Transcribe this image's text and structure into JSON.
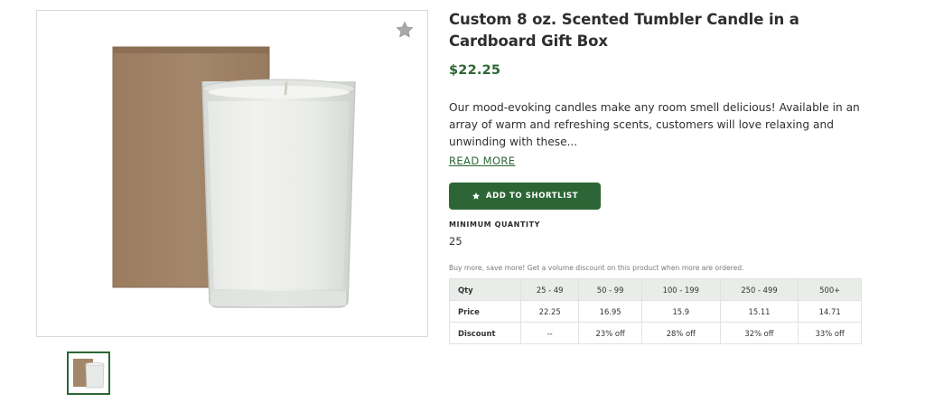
{
  "product": {
    "title": "Custom 8 oz. Scented Tumbler Candle in a Cardboard Gift Box",
    "price": "$22.25",
    "description": "Our mood-evoking candles make any room smell delicious! Available in an array of warm and refreshing scents, customers will love relaxing and unwinding with these...",
    "read_more": "READ MORE",
    "shortlist_label": "ADD TO SHORTLIST",
    "min_qty_label": "MINIMUM QUANTITY",
    "min_qty_value": "25",
    "volume_note": "Buy more, save more! Get a volume discount on this product when more are ordered."
  },
  "pricing": {
    "header": [
      "Qty",
      "25 - 49",
      "50 - 99",
      "100 - 199",
      "250 - 499",
      "500+"
    ],
    "price_row": [
      "Price",
      "22.25",
      "16.95",
      "15.9",
      "15.11",
      "14.71"
    ],
    "discount_row": [
      "Discount",
      "--",
      "23% off",
      "28% off",
      "32% off",
      "33% off"
    ]
  },
  "icons": {
    "favorite": "star-icon",
    "shortlist": "star-icon"
  },
  "colors": {
    "accent": "#2d6636",
    "table_header": "#e9ece9",
    "favorite_star": "#a8a8a8"
  }
}
